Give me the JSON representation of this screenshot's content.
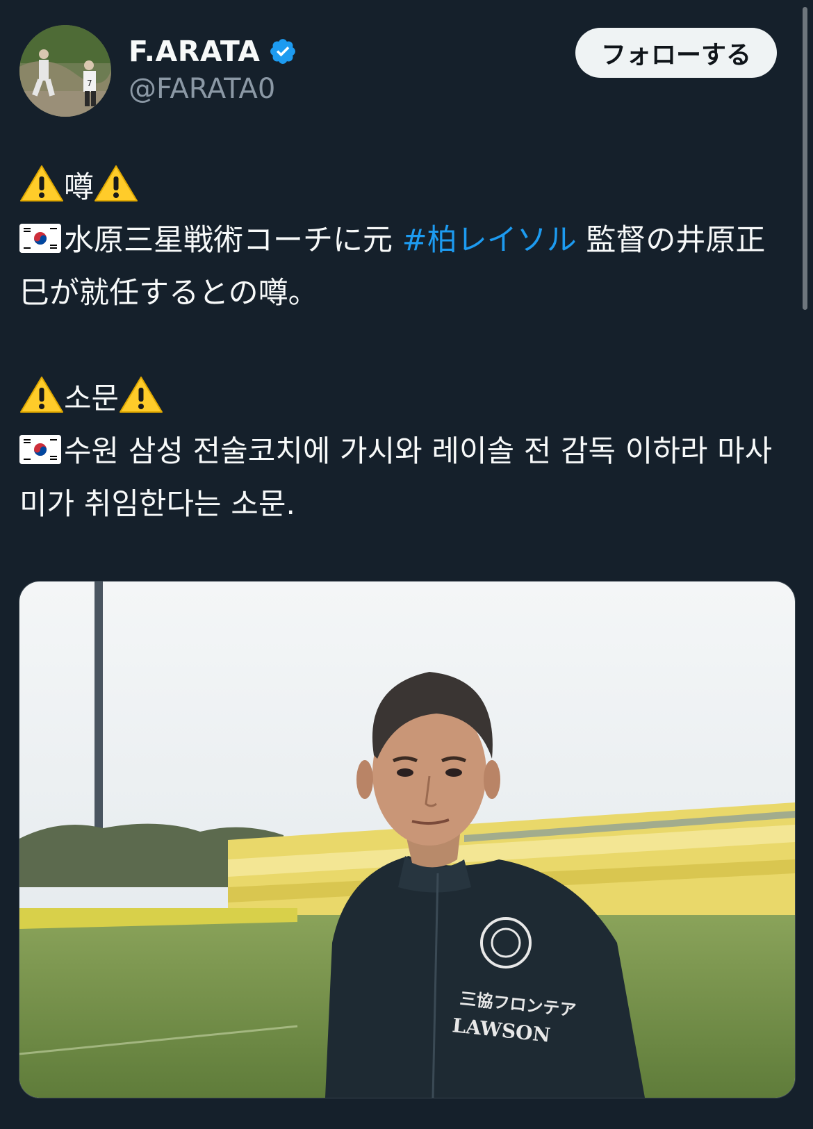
{
  "author": {
    "display_name": "F.ARATA",
    "handle": "@FARATA0",
    "verified": true,
    "verified_icon": "verified-badge-icon",
    "avatar_icon": "avatar-photo"
  },
  "follow_button": {
    "label": "フォローする"
  },
  "tweet": {
    "jp_heading": "噂",
    "jp_line_prefix": "水原三星戦術コーチに元 ",
    "jp_hashtag": "#柏レイソル",
    "jp_line_suffix": " 監督の井原正巳が就任するとの噂。",
    "kr_heading": "소문",
    "kr_line": "수원 삼성 전술코치에 가시와 레이솔 전 감독 이하라 마사미가 취임한다는 소문."
  },
  "icons": {
    "warning": "warning-icon",
    "flag": "south-korea-flag-icon"
  },
  "media": {
    "jacket_text_1": "三協フロンテア",
    "jacket_text_2": "LAWSON",
    "photo_icon": "coach-photo"
  },
  "colors": {
    "background": "#15202b",
    "text": "#f7f9f9",
    "secondary": "#8b98a5",
    "link": "#1d9bf0",
    "verified": "#1d9bf0",
    "button_bg": "#eff3f4"
  }
}
